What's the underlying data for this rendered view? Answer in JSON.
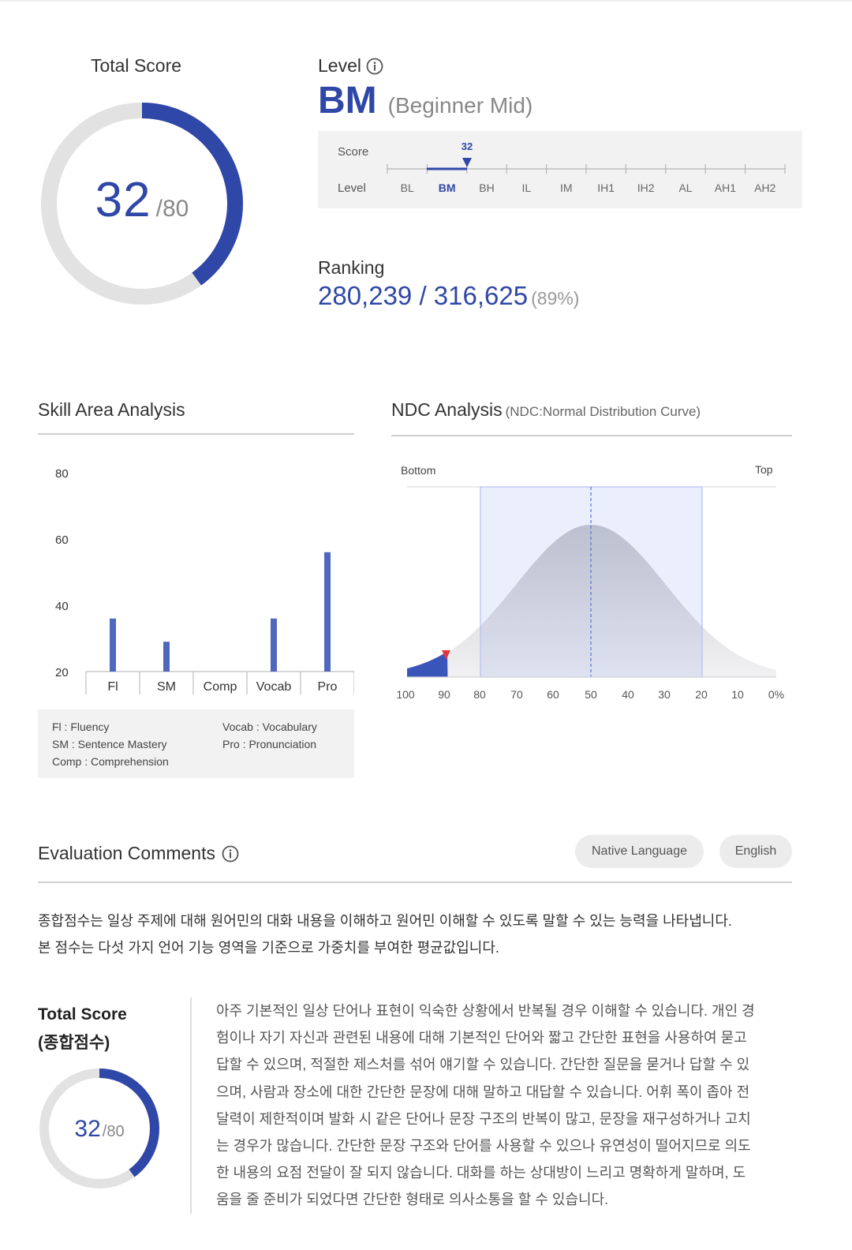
{
  "total_score": {
    "label": "Total Score",
    "value": "32",
    "max": "/80",
    "fraction": 0.4
  },
  "level": {
    "label": "Level",
    "code": "BM",
    "full": "(Beginner Mid)",
    "scale": {
      "score_label": "Score",
      "level_label": "Level",
      "marker_value": "32",
      "levels": [
        "BL",
        "BM",
        "BH",
        "IL",
        "IM",
        "IH1",
        "IH2",
        "AL",
        "AH1",
        "AH2"
      ],
      "active_level": "BM"
    }
  },
  "ranking": {
    "label": "Ranking",
    "value": "280,239 / 316,625",
    "percent": "(89%)"
  },
  "skill_area": {
    "title": "Skill Area Analysis",
    "legend": [
      "Fl : Fluency",
      "SM : Sentence Mastery",
      "Comp : Comprehension",
      "Vocab : Vocabulary",
      "Pro : Pronunciation"
    ]
  },
  "chart_data": {
    "type": "bar",
    "categories": [
      "Fl",
      "SM",
      "Comp",
      "Vocab",
      "Pro"
    ],
    "values": [
      36,
      29,
      0,
      36,
      56
    ],
    "yticks": [
      80,
      60,
      40,
      20
    ],
    "ylim": [
      20,
      80
    ],
    "bar_color": "#4f67bd"
  },
  "ndc": {
    "title": "NDC Analysis",
    "subtitle": "(NDC:Normal Distribution Curve)",
    "bottom_label": "Bottom",
    "top_label": "Top",
    "x_ticks": [
      "100",
      "90",
      "80",
      "70",
      "60",
      "50",
      "40",
      "30",
      "20",
      "10",
      "0%"
    ],
    "marker_percent": 89
  },
  "evaluation": {
    "title": "Evaluation Comments",
    "buttons": [
      "Native Language",
      "English"
    ],
    "paragraph": [
      "종합점수는 일상 주제에 대해 원어민의 대화 내용을 이해하고 원어민 이해할 수 있도록 말할 수 있는 능력을 나타냅니다.",
      "본 점수는 다섯 가지 언어 기능 영역을 기준으로 가중치를 부여한 평균값입니다."
    ],
    "total_title_1": "Total Score",
    "total_title_2": "(종합점수)",
    "score_value": "32",
    "score_max": "/80",
    "description": [
      "아주 기본적인 일상 단어나 표현이 익숙한 상황에서 반복될 경우 이해할 수 있습니다. 개인 경",
      "험이나 자기 자신과 관련된 내용에 대해 기본적인 단어와 짧고 간단한 표현을 사용하여 묻고",
      "답할 수 있으며, 적절한 제스처를 섞어 얘기할 수 있습니다. 간단한 질문을 묻거나 답할 수 있",
      "으며, 사람과 장소에 대한 간단한 문장에 대해 말하고 대답할 수 있습니다. 어휘 폭이 좁아 전",
      "달력이 제한적이며 발화 시 같은 단어나 문장 구조의 반복이 많고, 문장을 재구성하거나 고치",
      "는 경우가 많습니다. 간단한 문장 구조와 단어를 사용할 수 있으나 유연성이 떨어지므로 의도",
      "한 내용의 요점 전달이 잘 되지 않습니다. 대화를 하는 상대방이 느리고 명확하게 말하며, 도",
      "움을 줄 준비가 되었다면 간단한 형태로 의사소통을 할 수 있습니다."
    ]
  },
  "colors": {
    "accent": "#2f47a7",
    "bar": "#4f67bd",
    "track": "#e2e2e2",
    "panel": "#f2f2f2",
    "marker_red": "#e0373f"
  }
}
